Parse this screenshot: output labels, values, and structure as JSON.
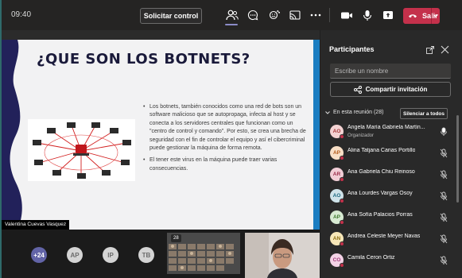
{
  "topbar": {
    "time": "09:40",
    "request_control_label": "Solicitar control",
    "leave_label": "Salir"
  },
  "slide": {
    "title": "¿QUE SON LOS BOTNETS?",
    "bullets": [
      "Los botnets, también conocidos como una red de bots son un software malicioso que se autopropaga, infecta al host y se conecta a los servidores centrales que funcionan como un \"centro de control y comando\". Por esto, se crea una brecha de seguridad con el fin de controlar el equipo y así el cibercriminal puede gestionar la máquina de forma remota.",
      "El tener este virus en la máquina puede traer varias consecuencias."
    ]
  },
  "presenter_name": "Valentina Cuevas Vasquez",
  "bottom_strip": {
    "more_count": "+24",
    "avatars": [
      "AP",
      "IP",
      "TB"
    ],
    "gallery_badge": "28"
  },
  "participants": {
    "title": "Participantes",
    "search_placeholder": "Escribe un nombre",
    "share_label": "Compartir invitación",
    "section_label": "En esta reunión (28)",
    "mute_all_label": "Silenciar a todos",
    "list": [
      {
        "initials": "AO",
        "name": "Angela María Gabriela Martín...",
        "role": "Organizador",
        "avatar_bg": "#f3d2d2",
        "avatar_fg": "#a4373a",
        "muted": false
      },
      {
        "initials": "AP",
        "name": "Alina Tatjana Carias Portillo",
        "role": "",
        "avatar_bg": "#f8dfc6",
        "avatar_fg": "#b35b1b",
        "muted": true
      },
      {
        "initials": "AR",
        "name": "Ana Gabriela Chiu Reinoso",
        "role": "",
        "avatar_bg": "#f1cdd6",
        "avatar_fg": "#9a2c4a",
        "muted": true
      },
      {
        "initials": "AO",
        "name": "Ana Lourdes Vargas Osoy",
        "role": "",
        "avatar_bg": "#cfe3ea",
        "avatar_fg": "#1d6a82",
        "muted": true
      },
      {
        "initials": "AP",
        "name": "Ana Sofía Palacios Porras",
        "role": "",
        "avatar_bg": "#d7ead2",
        "avatar_fg": "#3e7a2e",
        "muted": true
      },
      {
        "initials": "AN",
        "name": "Andrea Celeste Meyer Navas",
        "role": "",
        "avatar_bg": "#f7e7b8",
        "avatar_fg": "#8a6d10",
        "muted": true
      },
      {
        "initials": "CO",
        "name": "Camila Ceron Ortiz",
        "role": "",
        "avatar_bg": "#f3d2e6",
        "avatar_fg": "#a03a7a",
        "muted": true
      }
    ]
  }
}
